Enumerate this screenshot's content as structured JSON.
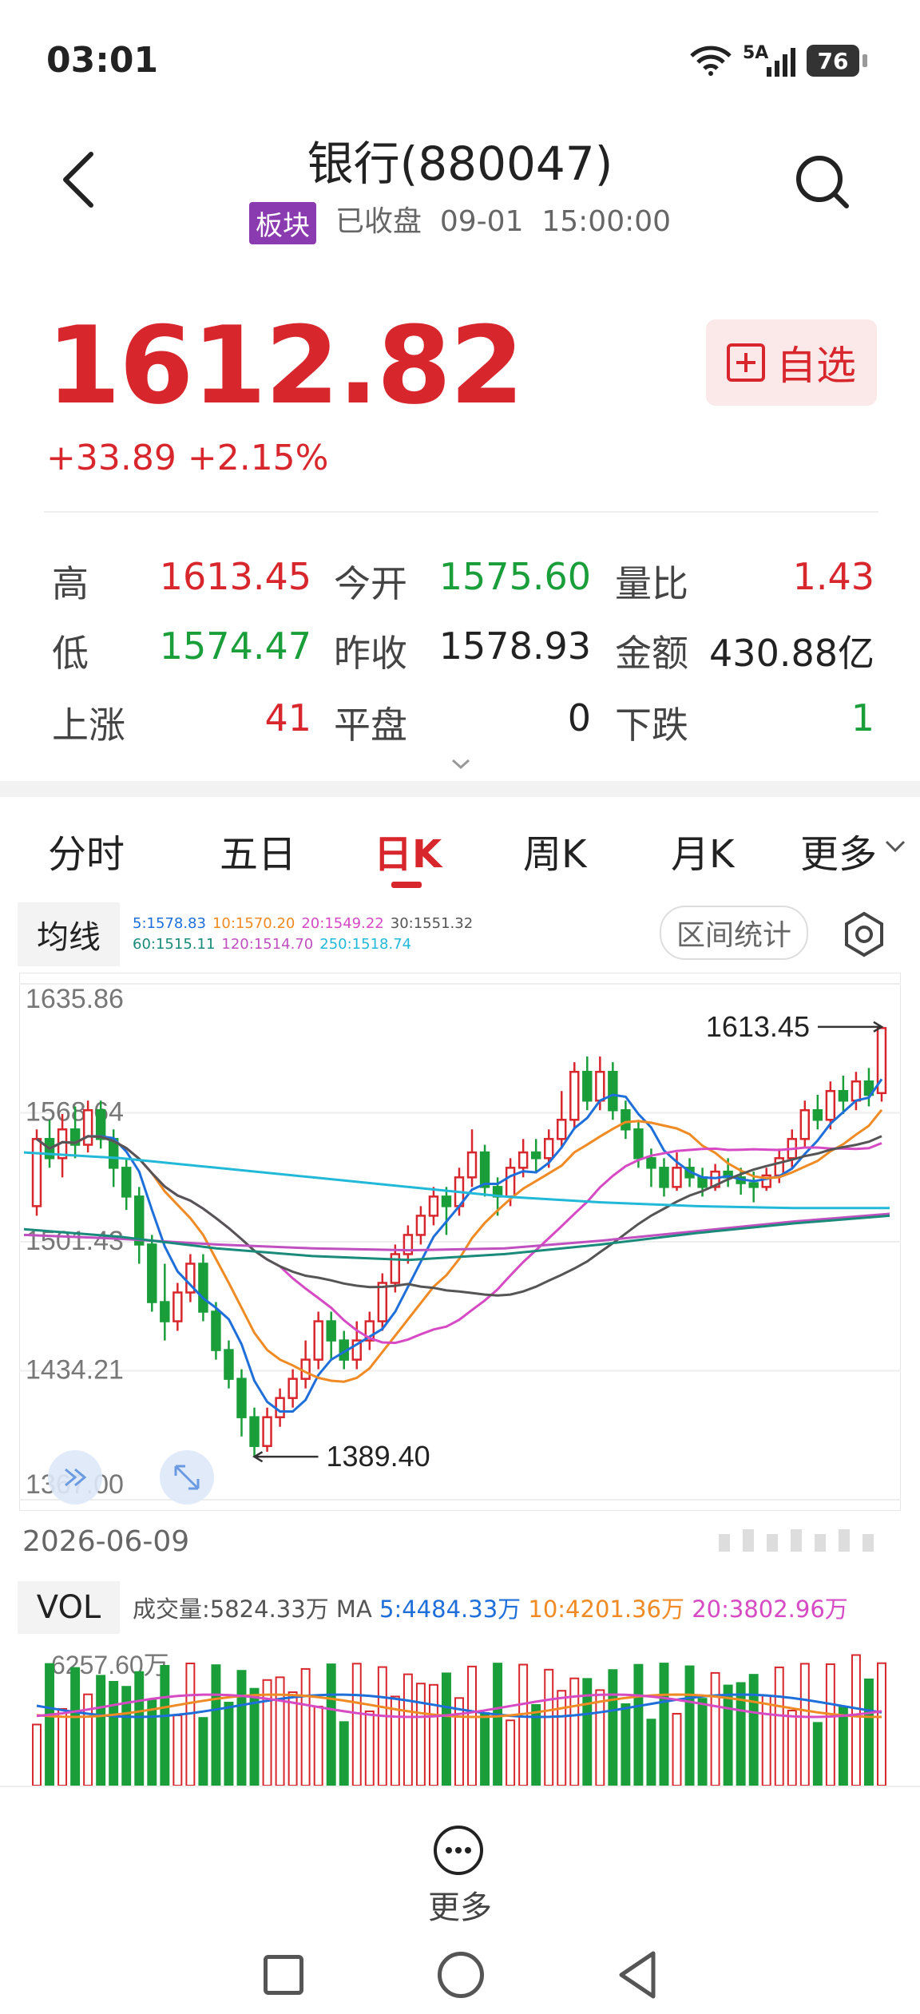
{
  "status": {
    "time": "03:01",
    "network": "5A",
    "battery": "76"
  },
  "header": {
    "title": "银行(880047)",
    "tag": "板块",
    "state": "已收盘",
    "date": "09-01",
    "clock": "15:00:00"
  },
  "quote": {
    "price": "1612.82",
    "change": "+33.89",
    "change_pct": "+2.15%",
    "add_label": "自选"
  },
  "stats": [
    {
      "label": "高",
      "value": "1613.45",
      "color": "red"
    },
    {
      "label": "今开",
      "value": "1575.60",
      "color": "green"
    },
    {
      "label": "量比",
      "value": "1.43",
      "color": "red"
    },
    {
      "label": "低",
      "value": "1574.47",
      "color": "green"
    },
    {
      "label": "昨收",
      "value": "1578.93",
      "color": "blk"
    },
    {
      "label": "金额",
      "value": "430.88亿",
      "color": "blk"
    },
    {
      "label": "上涨",
      "value": "41",
      "color": "red"
    },
    {
      "label": "平盘",
      "value": "0",
      "color": "blk"
    },
    {
      "label": "下跌",
      "value": "1",
      "color": "green"
    }
  ],
  "tabs": [
    "分时",
    "五日",
    "日K",
    "周K",
    "月K",
    "更多"
  ],
  "active_tab": "日K",
  "ma_panel": {
    "label": "均线",
    "line1": [
      {
        "text": "5:1578.83",
        "color": "#1e6fd9"
      },
      {
        "text": "10:1570.20",
        "color": "#f08a24"
      },
      {
        "text": "20:1549.22",
        "color": "#d64ac4"
      },
      {
        "text": "30:1551.32",
        "color": "#555555"
      }
    ],
    "line2": [
      {
        "text": "60:1515.11",
        "color": "#1a8a7a"
      },
      {
        "text": "120:1514.70",
        "color": "#c050c0"
      },
      {
        "text": "250:1518.74",
        "color": "#22b8d8"
      }
    ],
    "stats_button": "区间统计"
  },
  "chart_data": {
    "type": "candlestick",
    "y_ticks": [
      "1635.86",
      "1568.64",
      "1501.43",
      "1434.21",
      "1367.00"
    ],
    "ylim": [
      1367.0,
      1635.86
    ],
    "high_label": "1613.45",
    "low_label": "1389.40",
    "start_date": "2026-06-09",
    "candles": [
      [
        1520,
        1555,
        1515,
        1560
      ],
      [
        1555,
        1545,
        1540,
        1565
      ],
      [
        1545,
        1560,
        1535,
        1568
      ],
      [
        1560,
        1552,
        1545,
        1572
      ],
      [
        1552,
        1570,
        1548,
        1575
      ],
      [
        1570,
        1555,
        1550,
        1575
      ],
      [
        1555,
        1540,
        1530,
        1560
      ],
      [
        1540,
        1525,
        1518,
        1545
      ],
      [
        1525,
        1500,
        1490,
        1530
      ],
      [
        1500,
        1470,
        1465,
        1505
      ],
      [
        1470,
        1460,
        1450,
        1490
      ],
      [
        1460,
        1475,
        1455,
        1480
      ],
      [
        1475,
        1490,
        1470,
        1495
      ],
      [
        1490,
        1465,
        1460,
        1495
      ],
      [
        1465,
        1445,
        1440,
        1470
      ],
      [
        1445,
        1430,
        1425,
        1450
      ],
      [
        1430,
        1410,
        1400,
        1435
      ],
      [
        1410,
        1395,
        1389.4,
        1415
      ],
      [
        1395,
        1410,
        1392,
        1415
      ],
      [
        1410,
        1420,
        1405,
        1425
      ],
      [
        1420,
        1430,
        1415,
        1435
      ],
      [
        1430,
        1440,
        1425,
        1450
      ],
      [
        1440,
        1460,
        1435,
        1465
      ],
      [
        1460,
        1450,
        1440,
        1465
      ],
      [
        1450,
        1440,
        1435,
        1455
      ],
      [
        1440,
        1450,
        1435,
        1460
      ],
      [
        1450,
        1460,
        1445,
        1465
      ],
      [
        1460,
        1480,
        1455,
        1485
      ],
      [
        1480,
        1495,
        1475,
        1500
      ],
      [
        1495,
        1505,
        1490,
        1510
      ],
      [
        1505,
        1515,
        1500,
        1520
      ],
      [
        1515,
        1525,
        1510,
        1530
      ],
      [
        1525,
        1520,
        1505,
        1530
      ],
      [
        1520,
        1535,
        1515,
        1540
      ],
      [
        1535,
        1548,
        1530,
        1560
      ],
      [
        1548,
        1530,
        1525,
        1552
      ],
      [
        1530,
        1525,
        1515,
        1535
      ],
      [
        1525,
        1540,
        1520,
        1545
      ],
      [
        1540,
        1548,
        1535,
        1555
      ],
      [
        1548,
        1545,
        1538,
        1555
      ],
      [
        1545,
        1555,
        1540,
        1560
      ],
      [
        1555,
        1565,
        1550,
        1580
      ],
      [
        1565,
        1590,
        1560,
        1595
      ],
      [
        1590,
        1575,
        1570,
        1598
      ],
      [
        1575,
        1590,
        1570,
        1598
      ],
      [
        1590,
        1570,
        1565,
        1595
      ],
      [
        1570,
        1560,
        1555,
        1575
      ],
      [
        1560,
        1545,
        1540,
        1565
      ],
      [
        1545,
        1540,
        1530,
        1550
      ],
      [
        1540,
        1530,
        1525,
        1545
      ],
      [
        1530,
        1540,
        1528,
        1548
      ],
      [
        1540,
        1535,
        1530,
        1545
      ],
      [
        1535,
        1530,
        1525,
        1540
      ],
      [
        1530,
        1538,
        1528,
        1542
      ],
      [
        1538,
        1535,
        1530,
        1545
      ],
      [
        1535,
        1532,
        1526,
        1540
      ],
      [
        1532,
        1530,
        1522,
        1538
      ],
      [
        1530,
        1536,
        1528,
        1540
      ],
      [
        1536,
        1545,
        1532,
        1550
      ],
      [
        1545,
        1555,
        1540,
        1560
      ],
      [
        1555,
        1570,
        1550,
        1575
      ],
      [
        1570,
        1565,
        1560,
        1578
      ],
      [
        1565,
        1580,
        1560,
        1585
      ],
      [
        1580,
        1575,
        1568,
        1588
      ],
      [
        1575,
        1585,
        1570,
        1590
      ],
      [
        1585,
        1578,
        1572,
        1592
      ],
      [
        1578.93,
        1612.82,
        1574.47,
        1613.45
      ]
    ]
  },
  "xaxis": {
    "start_label": "2026-06-09"
  },
  "volume": {
    "label": "VOL",
    "info": [
      {
        "text": "成交量:5824.33万",
        "color": "#555555"
      },
      {
        "text": " MA ",
        "color": "#555555"
      },
      {
        "text": "5:4484.33万",
        "color": "#1e6fd9"
      },
      {
        "text": " 10:4201.36万",
        "color": "#f08a24"
      },
      {
        "text": " 20:3802.96万",
        "color": "#d64ac4"
      }
    ],
    "max_label": "6257.60万"
  },
  "bottom": {
    "more_label": "更多"
  }
}
